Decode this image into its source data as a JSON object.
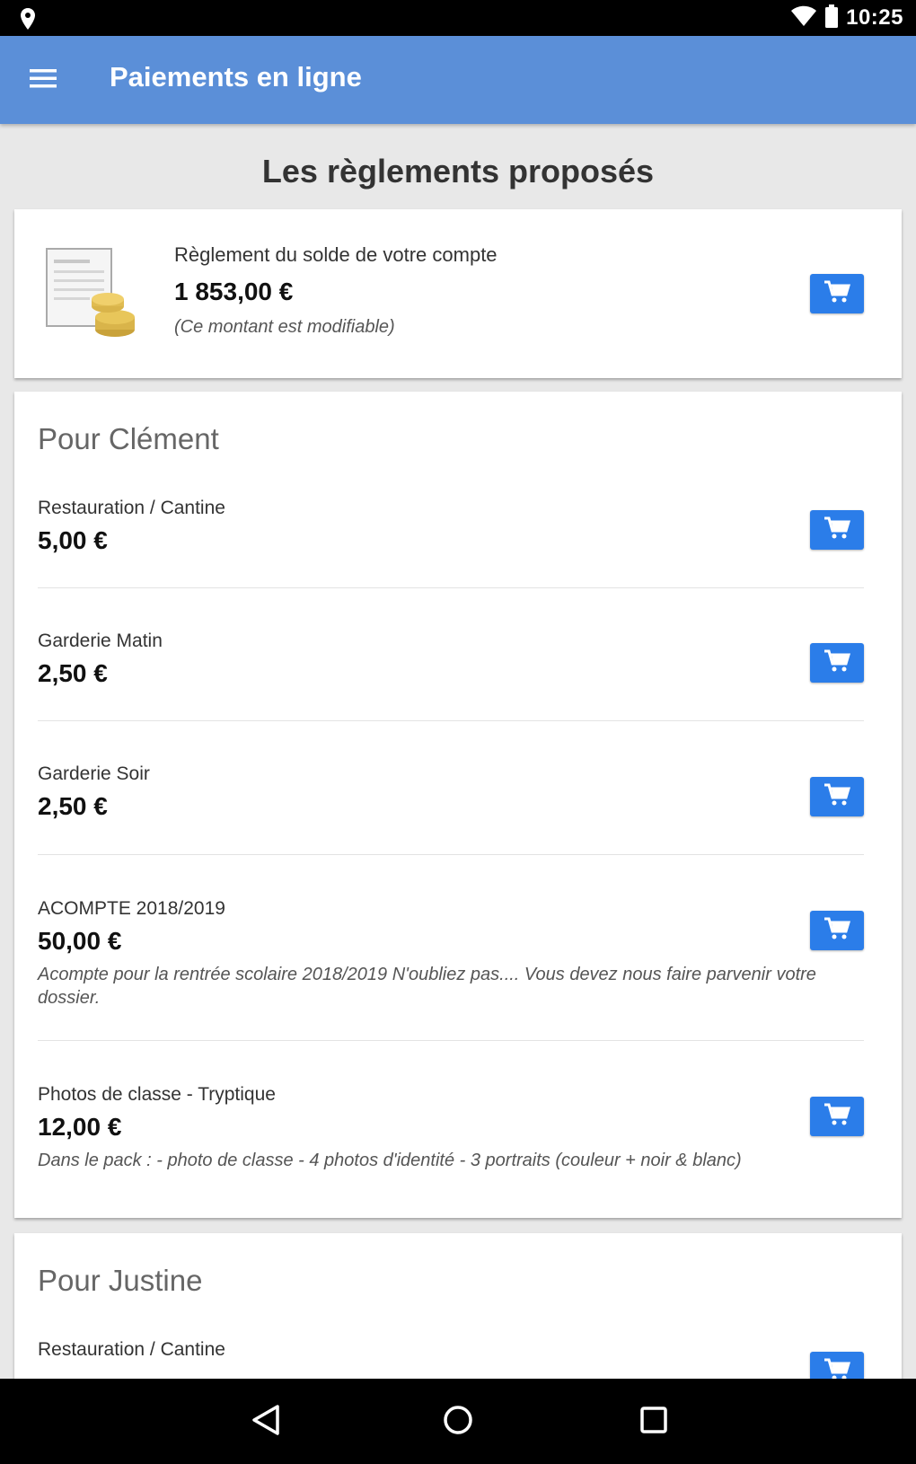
{
  "status_bar": {
    "time": "10:25"
  },
  "app_bar": {
    "title": "Paiements en ligne"
  },
  "page": {
    "section_title": "Les règlements proposés"
  },
  "balance": {
    "label": "Règlement du solde de votre compte",
    "amount": "1 853,00 €",
    "note": "(Ce montant est modifiable)"
  },
  "children": [
    {
      "name": "Pour Clément",
      "items": [
        {
          "label": "Restauration / Cantine",
          "amount": "5,00 €",
          "description": ""
        },
        {
          "label": "Garderie Matin",
          "amount": "2,50 €",
          "description": ""
        },
        {
          "label": "Garderie Soir",
          "amount": "2,50 €",
          "description": ""
        },
        {
          "label": "ACOMPTE 2018/2019",
          "amount": "50,00 €",
          "description": "Acompte pour la rentrée scolaire 2018/2019 N'oubliez pas.... Vous devez nous faire parvenir votre dossier."
        },
        {
          "label": "Photos de classe - Tryptique",
          "amount": "12,00 €",
          "description": "Dans le pack : - photo de classe - 4 photos d'identité - 3 portraits (couleur + noir & blanc)"
        }
      ]
    },
    {
      "name": "Pour Justine",
      "items": [
        {
          "label": "Restauration / Cantine",
          "amount": "",
          "description": ""
        }
      ]
    }
  ],
  "colors": {
    "app_bar": "#5b8fd8",
    "cart_button": "#2b7de9",
    "background": "#e8e8e8"
  },
  "icons": [
    "location-icon",
    "wifi-icon",
    "battery-icon",
    "menu-icon",
    "invoice-coins-icon",
    "cart-icon",
    "back-icon",
    "home-icon",
    "recents-icon"
  ]
}
